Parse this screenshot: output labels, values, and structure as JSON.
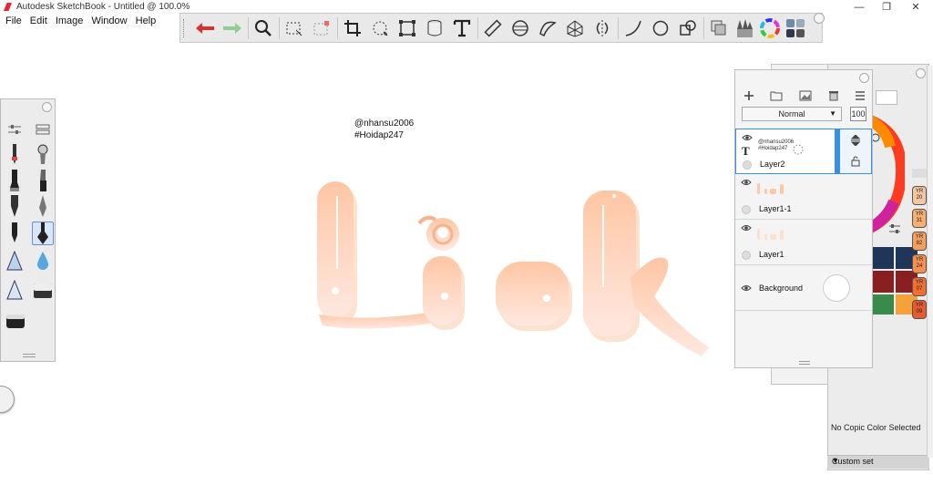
{
  "window": {
    "title": "Autodesk SketchBook - Untitled @ 100.0%",
    "minimize": "—",
    "maximize": "❐",
    "close": "✕"
  },
  "menu": [
    "File",
    "Edit",
    "Image",
    "Window",
    "Help"
  ],
  "canvas": {
    "caption_line1": "@nhansu2006",
    "caption_line2": "#Hoidap247"
  },
  "artwork": {
    "fill_top": "#ffc6a4",
    "fill_bottom": "#ffe8e0",
    "shadow": "#fde0c8"
  },
  "layers": {
    "blend_mode": "Normal",
    "opacity": "100",
    "items": [
      {
        "name": "Layer2",
        "thumb_line1": "@nhansu2006",
        "thumb_line2": "#Hoidap247",
        "selected": true
      },
      {
        "name": "Layer1-1"
      },
      {
        "name": "Layer1"
      },
      {
        "name": "Background"
      }
    ]
  },
  "color_panel": {
    "swatches": [
      "#1f3659",
      "#8a1f22",
      "#3a8a4b",
      "#f7a13a"
    ],
    "copic_labels": [
      "YR 20",
      "YR 31",
      "YR 82",
      "YR 24",
      "YR 07",
      "YR 09"
    ],
    "copic_colors": [
      "#f6c6a0",
      "#f7b070",
      "#f6a060",
      "#f59050",
      "#f07030",
      "#e85a30"
    ],
    "no_copic": "No Copic Color Selected",
    "custom_set": "Custom set"
  },
  "accent": "#3b8fe0"
}
